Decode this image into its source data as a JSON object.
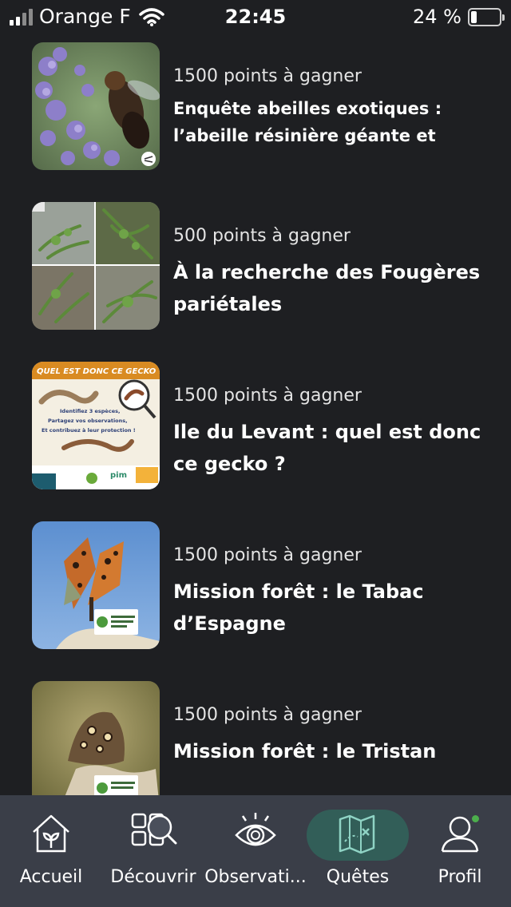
{
  "status_bar": {
    "carrier": "Orange F",
    "time": "22:45",
    "battery": "24 %",
    "battery_level": 0.24
  },
  "quests": [
    {
      "points": "1500 points à gagner",
      "title": "Enquête abeilles exotiques : l’abeille résinière géante et",
      "image": "bee-on-lavender-photo"
    },
    {
      "points": "500 points à gagner",
      "title": "À la recherche des Fougères pariétales",
      "image": "fern-collage-photo"
    },
    {
      "points": "1500 points à gagner",
      "title": "Ile du Levant : quel est donc ce gecko ?",
      "image": "gecko-poster",
      "image_texts": {
        "headline": "QUEL EST DONC CE GECKO ?",
        "body": "Identifiez 3 espèces, Partagez vos observations, Et contribuez à leur protection !"
      }
    },
    {
      "points": "1500 points à gagner",
      "title": "Mission forêt : le Tabac d’Espagne",
      "image": "orange-butterfly-photo"
    },
    {
      "points": "1500 points à gagner",
      "title": "Mission forêt : le Tristan",
      "image": "brown-butterfly-photo"
    }
  ],
  "nav": {
    "items": [
      {
        "label": "Accueil",
        "icon": "house-sprout-icon",
        "active": false
      },
      {
        "label": "Découvrir",
        "icon": "grid-search-icon",
        "active": false
      },
      {
        "label": "Observati...",
        "icon": "eye-icon",
        "active": false
      },
      {
        "label": "Quêtes",
        "icon": "treasure-map-icon",
        "active": true
      },
      {
        "label": "Profil",
        "icon": "user-icon",
        "active": false
      }
    ],
    "active_color": "#325e58",
    "notification_color": "#4cae4c"
  }
}
